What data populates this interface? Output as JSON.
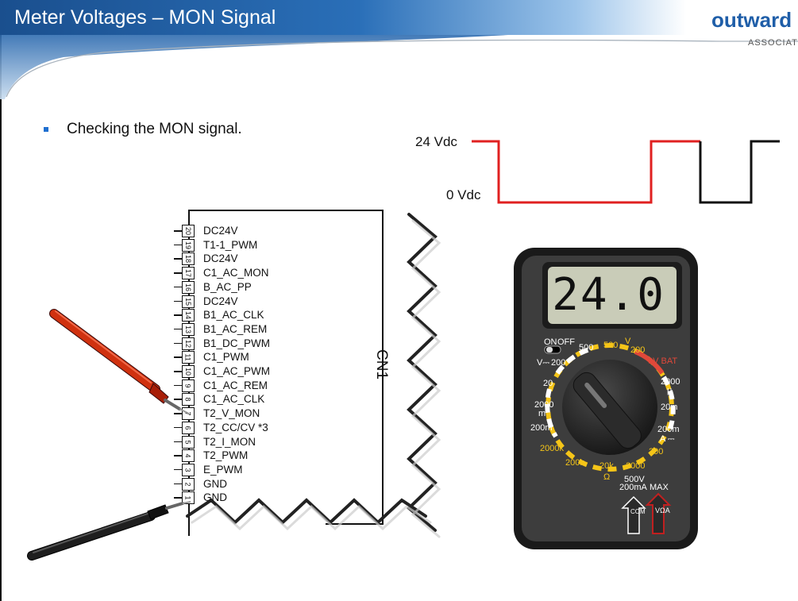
{
  "slide": {
    "title": "Meter Voltages – MON Signal",
    "bullet": "Checking the MON signal."
  },
  "logo": {
    "word": "outward",
    "sub": "ASSOCIATES"
  },
  "waveform": {
    "high_label": "24 Vdc",
    "low_label": "0 Vdc",
    "highlight_color": "#e02020",
    "base_color": "#111111"
  },
  "connector": {
    "name": "CN1",
    "pins": [
      {
        "num": "20",
        "label": "DC24V"
      },
      {
        "num": "19",
        "label": "T1-1_PWM"
      },
      {
        "num": "18",
        "label": "DC24V"
      },
      {
        "num": "17",
        "label": "C1_AC_MON"
      },
      {
        "num": "16",
        "label": "B_AC_PP"
      },
      {
        "num": "15",
        "label": "DC24V"
      },
      {
        "num": "14",
        "label": "B1_AC_CLK"
      },
      {
        "num": "13",
        "label": "B1_AC_REM"
      },
      {
        "num": "12",
        "label": "B1_DC_PWM"
      },
      {
        "num": "11",
        "label": "C1_PWM"
      },
      {
        "num": "10",
        "label": "C1_AC_PWM"
      },
      {
        "num": "9",
        "label": "C1_AC_REM"
      },
      {
        "num": "8",
        "label": "C1_AC_CLK"
      },
      {
        "num": "7",
        "label": "T2_V_MON"
      },
      {
        "num": "6",
        "label": "T2_CC/CV *3"
      },
      {
        "num": "5",
        "label": "T2_I_MON"
      },
      {
        "num": "4",
        "label": "T2_PWM"
      },
      {
        "num": "3",
        "label": "E_PWM"
      },
      {
        "num": "2",
        "label": "GND"
      },
      {
        "num": "1",
        "label": "GND"
      }
    ]
  },
  "probes": {
    "red_probe_pin": "7",
    "black_probe_pin": "1"
  },
  "multimeter": {
    "display": "24.0",
    "dial": {
      "on": "ON",
      "off": "OFF",
      "v_500w": "500",
      "v_500y": "500",
      "v_sym": "V",
      "v_200y": "200",
      "bat": "9V BAT",
      "vdc": "V⎓",
      "vdc_200": "200",
      "v_20": "20",
      "i_2000": "2000",
      "mu": "μ",
      "m_2000": "2000",
      "m_sym": "m",
      "i_20m": "20m",
      "r_200m": "200m",
      "i_200m": "200m",
      "a_dc": "A ⎓",
      "i_200": "200",
      "r_2000k": "2000k",
      "r_200k": "200k",
      "r_20k": "20k",
      "r_2000": "2000",
      "ohm": "Ω",
      "max1": "500V",
      "max2": "200mA",
      "max3": "MAX"
    },
    "jack_com": "COM",
    "jack_voa": "VΩA"
  },
  "colors": {
    "title_bg": "#1c5fa5",
    "meter_body": "#3d3d3d",
    "accent_yellow": "#f5c518",
    "accent_red": "#e0483a"
  }
}
